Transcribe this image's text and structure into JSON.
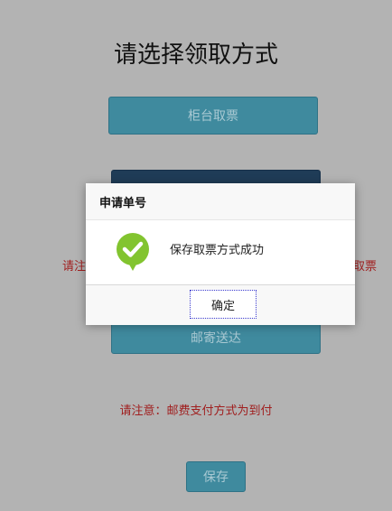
{
  "page": {
    "title": "请选择领取方式",
    "counter_button_label": "柜台取票",
    "notice_left": "请注",
    "notice_right": "取票",
    "mail_button_label": "邮寄送达",
    "mail_notice": "请注意：邮费支付方式为到付",
    "save_button_label": "保存"
  },
  "modal": {
    "title": "申请单号",
    "message": "保存取票方式成功",
    "ok_label": "确定",
    "icon": "success-check-icon",
    "icon_color": "#82c42f"
  }
}
